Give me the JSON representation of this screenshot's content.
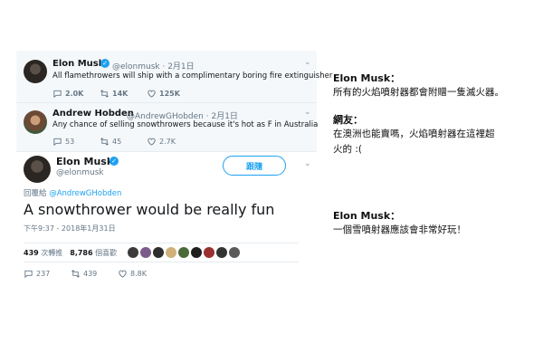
{
  "tweet1": {
    "name": "Elon Musk",
    "handle_date": "@elonmusk · 2月1日",
    "text": "All flamethrowers will ship with a complimentary boring fire extinguisher",
    "replies": "2.0K",
    "retweets": "14K",
    "likes": "125K"
  },
  "tweet2": {
    "name": "Andrew Hobden",
    "handle_date": "@AndrewGHobden · 2月1日",
    "text": "Any chance of selling snowthrowers because it's hot as F in Australia",
    "replies": "53",
    "retweets": "45",
    "likes": "2.7K"
  },
  "tweet3": {
    "name": "Elon Musk",
    "handle": "@elonmusk",
    "follow_label": "跟隨",
    "reply_prefix": "回覆給",
    "reply_to": "@AndrewGHobden",
    "text": "A snowthrower would be really fun",
    "timestamp": "下午9:37 - 2018年1月31日",
    "retweet_count": "439",
    "retweet_label": "次轉推",
    "like_count": "8,786",
    "like_label": "個喜歡",
    "replies": "237",
    "retweets": "439",
    "likes": "8.8K",
    "liker_colors": [
      "#3b3b3b",
      "#7a5c8a",
      "#2e2e2e",
      "#d0b07a",
      "#4a6a3a",
      "#1f1f1f",
      "#9a3030",
      "#333333",
      "#5a5a5a"
    ]
  },
  "notes": {
    "note1_title": "Elon Musk：",
    "note1_text": "所有的火焰噴射器都會附贈一隻滅火器。",
    "note2_title": "網友：",
    "note2_line1": "在澳洲也能賣嗎，火焰噴射器在這裡超",
    "note2_line2": "火的 :(",
    "note3_title": "Elon Musk：",
    "note3_text": "一個雪噴射器應該會非常好玩！"
  },
  "colors": {
    "accent": "#1da1f2",
    "muted": "#657786",
    "reply_bg": "#f5f8fa"
  }
}
